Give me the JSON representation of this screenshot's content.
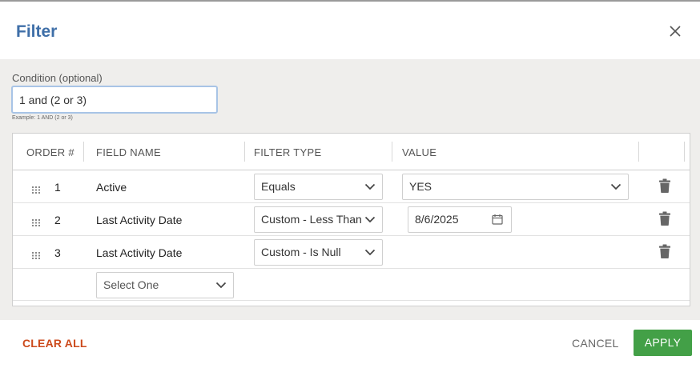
{
  "dialog": {
    "title": "Filter",
    "close_icon": "close-icon"
  },
  "condition": {
    "label": "Condition (optional)",
    "value": "1 and (2 or 3)",
    "hint": "Example: 1 AND (2 or 3)"
  },
  "table": {
    "headers": {
      "order": "ORDER #",
      "field_name": "FIELD NAME",
      "filter_type": "FILTER TYPE",
      "value": "VALUE"
    },
    "rows": [
      {
        "order": "1",
        "field_name": "Active",
        "filter_type": "Equals",
        "value": "YES",
        "value_kind": "select"
      },
      {
        "order": "2",
        "field_name": "Last Activity Date",
        "filter_type": "Custom - Less Than",
        "value": "8/6/2025",
        "value_kind": "date"
      },
      {
        "order": "3",
        "field_name": "Last Activity Date",
        "filter_type": "Custom - Is Null",
        "value": "",
        "value_kind": "none"
      }
    ],
    "new_row": {
      "field_placeholder": "Select One"
    }
  },
  "footer": {
    "clear_all": "CLEAR ALL",
    "cancel": "CANCEL",
    "apply": "APPLY"
  },
  "colors": {
    "title": "#3f6fa8",
    "clear_all": "#cc4a1c",
    "apply_bg": "#43a047",
    "body_bg": "#efeeec"
  }
}
